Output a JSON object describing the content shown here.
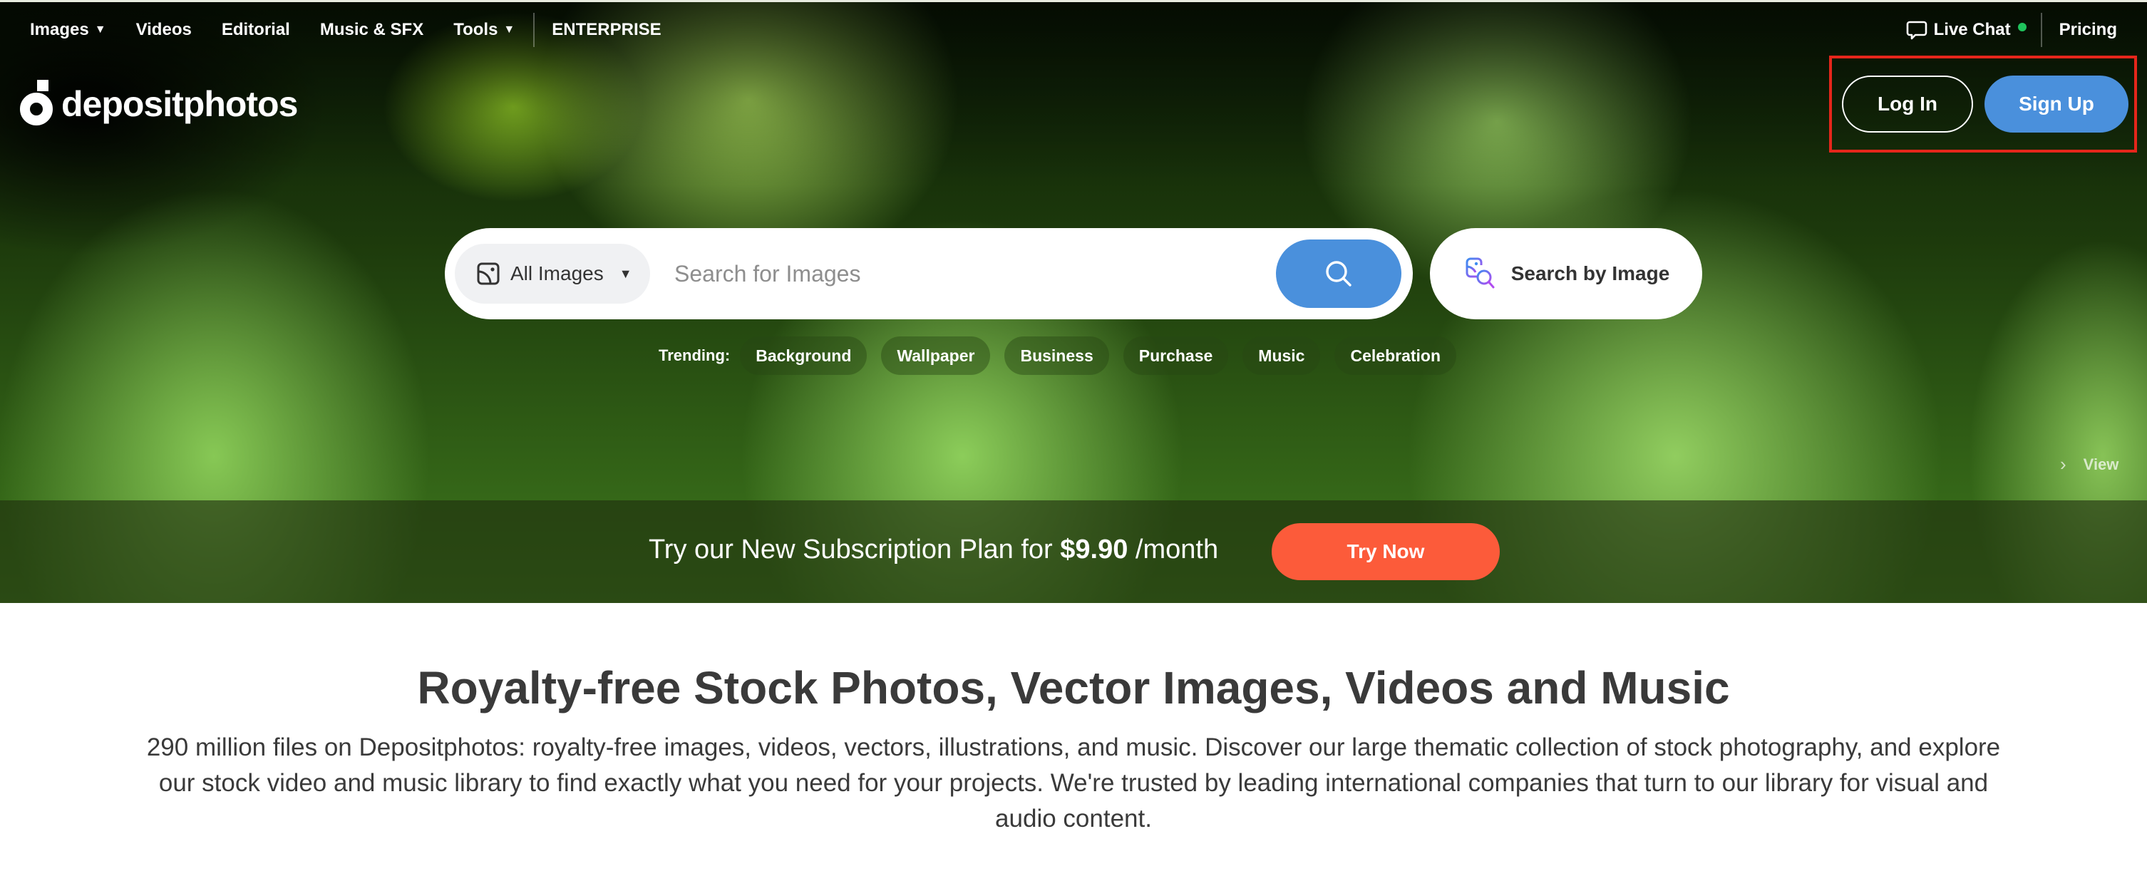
{
  "nav": {
    "items": [
      {
        "label": "Images",
        "has_caret": true
      },
      {
        "label": "Videos",
        "has_caret": false
      },
      {
        "label": "Editorial",
        "has_caret": false
      },
      {
        "label": "Music & SFX",
        "has_caret": false
      },
      {
        "label": "Tools",
        "has_caret": true
      }
    ],
    "enterprise": "ENTERPRISE",
    "caret_glyph": "▼",
    "live_chat": "Live Chat",
    "live_chat_status": "online",
    "pricing": "Pricing"
  },
  "logo": {
    "text": "depositphotos",
    "icon": "depositphotos-logo-icon"
  },
  "auth": {
    "login": "Log In",
    "signup": "Sign Up"
  },
  "search": {
    "category": "All Images",
    "category_caret": "▼",
    "placeholder": "Search for Images",
    "value": "",
    "search_icon": "search-icon",
    "by_image_label": "Search by Image"
  },
  "trending": {
    "label": "Trending:",
    "tags": [
      "Background",
      "Wallpaper",
      "Business",
      "Purchase",
      "Music",
      "Celebration"
    ]
  },
  "view_link": {
    "chevron": "›",
    "label": "View"
  },
  "promo": {
    "text_before": "Try our New Subscription Plan for ",
    "price": "$9.90",
    "text_after": " /month",
    "button": "Try Now"
  },
  "content": {
    "headline": "Royalty-free Stock Photos, Vector Images, Videos and Music",
    "description": "290 million files on Depositphotos: royalty-free images, videos, vectors, illustrations, and music. Discover our large thematic collection of stock photography, and explore our stock video and music library to find exactly what you need for your projects. We're trusted by leading international companies that turn to our library for visual and audio content."
  },
  "colors": {
    "accent_blue": "#4a90dc",
    "promo_orange": "#fc5b3a",
    "online_green": "#1fc35c",
    "highlight_red": "#e5261b",
    "text_dark": "#3a3a3a"
  }
}
